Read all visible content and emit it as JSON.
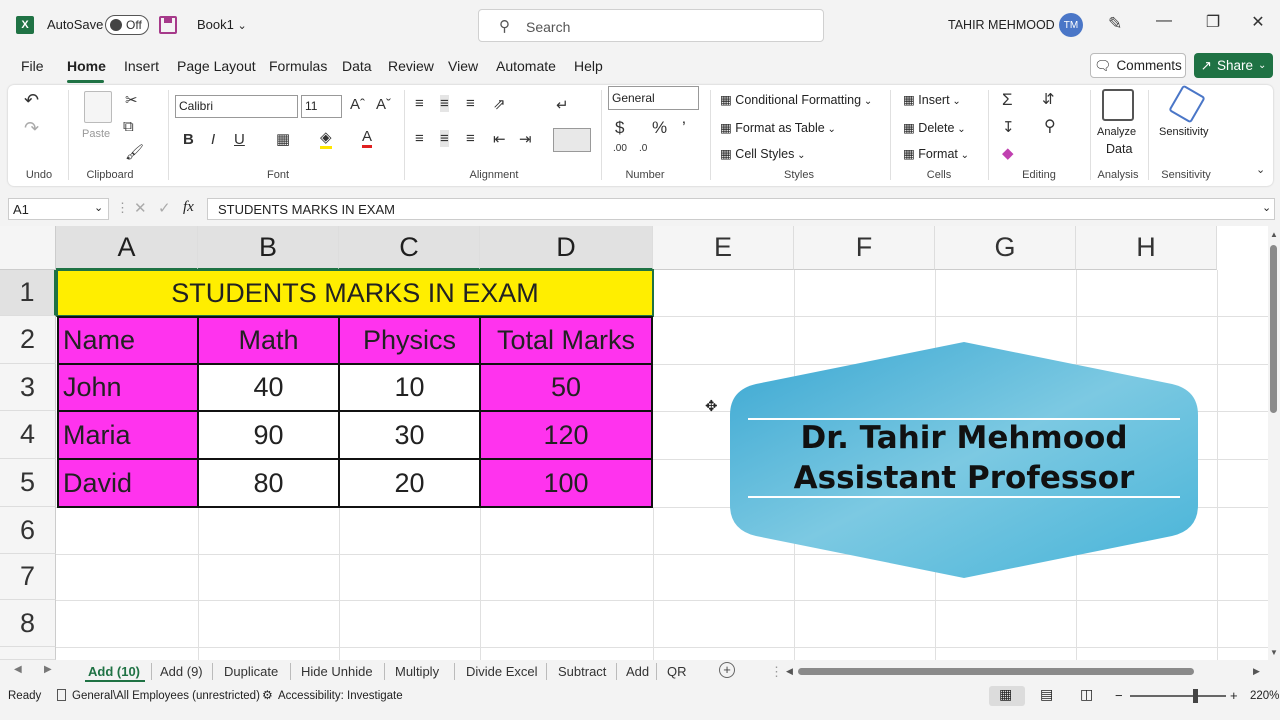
{
  "titlebar": {
    "autosave_label": "AutoSave",
    "autosave_state": "Off",
    "book_title": "Book1",
    "search_placeholder": "Search",
    "user_name": "TAHIR MEHMOOD",
    "user_initials": "TM",
    "minimize": "—",
    "restore": "❐",
    "close": "✕"
  },
  "menu": {
    "tabs": [
      "File",
      "Home",
      "Insert",
      "Page Layout",
      "Formulas",
      "Data",
      "Review",
      "View",
      "Automate",
      "Help"
    ],
    "comments_label": "Comments",
    "share_label": "Share"
  },
  "ribbon": {
    "groups": {
      "undo": "Undo",
      "clipboard": "Clipboard",
      "font": "Font",
      "alignment": "Alignment",
      "number": "Number",
      "styles": "Styles",
      "cells": "Cells",
      "editing": "Editing",
      "analysis": "Analysis",
      "sensitivity": "Sensitivity"
    },
    "paste_label": "Paste",
    "font_name": "Calibri",
    "font_size": "11",
    "number_format": "General",
    "conditional_formatting": "Conditional Formatting",
    "format_as_table": "Format as Table",
    "cell_styles": "Cell Styles",
    "insert": "Insert",
    "delete": "Delete",
    "format": "Format",
    "analyze_data_1": "Analyze",
    "analyze_data_2": "Data",
    "sensitivity_btn": "Sensitivity"
  },
  "formula_bar": {
    "name_box": "A1",
    "fx": "fx",
    "content": "STUDENTS MARKS IN EXAM"
  },
  "sheet": {
    "columns": [
      "A",
      "B",
      "C",
      "D",
      "E",
      "F",
      "G",
      "H"
    ],
    "rows": [
      "1",
      "2",
      "3",
      "4",
      "5",
      "6",
      "7",
      "8"
    ],
    "title": "STUDENTS MARKS IN EXAM",
    "headers": [
      "Name",
      "Math",
      "Physics",
      "Total Marks"
    ],
    "data": [
      [
        "John",
        "40",
        "10",
        "50"
      ],
      [
        "Maria",
        "90",
        "30",
        "120"
      ],
      [
        "David",
        "80",
        "20",
        "100"
      ]
    ]
  },
  "banner": {
    "line1": "Dr. Tahir Mehmood",
    "line2": "Assistant Professor"
  },
  "sheet_tabs": [
    "Add (10)",
    "Add (9)",
    "Duplicate",
    "Hide Unhide",
    "Multiply",
    "Divide Excel",
    "Subtract",
    "Add",
    "QR"
  ],
  "status": {
    "ready": "Ready",
    "sensitivity": "General\\All Employees (unrestricted)",
    "accessibility": "Accessibility: Investigate",
    "zoom": "220%"
  },
  "colors": {
    "excel_green": "#1f7244",
    "title_fill": "#ffee00",
    "pink_fill": "#ff33ee",
    "banner_blue": "#5bbad9"
  }
}
